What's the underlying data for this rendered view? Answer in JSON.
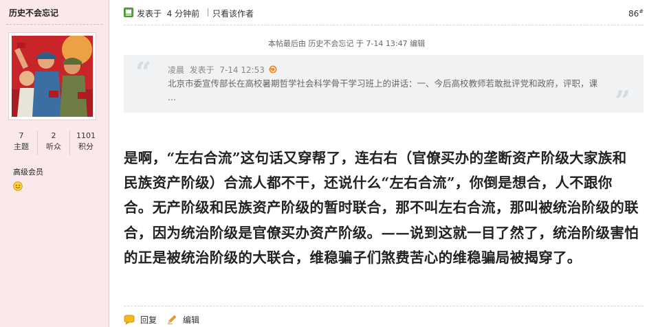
{
  "user": {
    "name": "历史不会忘记",
    "stats": [
      {
        "value": "7",
        "label": "主题"
      },
      {
        "value": "2",
        "label": "听众"
      },
      {
        "value": "1101",
        "label": "积分"
      }
    ],
    "group": "高级会员",
    "avatar_icon": "propaganda-poster-avatar",
    "status_icon": "smiley-icon"
  },
  "post": {
    "posted_label": "发表于",
    "posted_time": "4 分钟前",
    "only_author": "只看该作者",
    "floor_number": "86",
    "floor_mark": "#",
    "edit_note": "本帖最后由 历史不会忘记 于 7-14 13:47 编辑",
    "quote": {
      "author": "凌晨",
      "posted_label": "发表于",
      "posted_time": "7-14 12:53",
      "text": "北京市委宣传部长在高校暑期哲学社会科学骨干学习班上的讲话：一、今后高校教师若敢批评党和政府，评职，课 ..."
    },
    "body": "是啊，“左右合流”这句话又穿帮了，连右右（官僚买办的垄断资产阶级大家族和民族资产阶级）合流人都不干，还说什么“左右合流”，你倒是想合，人不跟你合。无产阶级和民族资产阶级的暂时联合，那不叫左右合流，那叫被统治阶级的联合，因为统治阶级是官僚买办资产阶级。——说到这就一目了然了，统治阶级害怕的正是被统治阶级的大联合，维稳骗子们煞费苦心的维稳骗局被揭穿了。",
    "actions": {
      "reply_label": "回复",
      "edit_label": "编辑"
    }
  },
  "colors": {
    "sidebar_bg": "#fbe8ea",
    "quote_bg": "#f1f2f4",
    "accent_green": "#5aa640",
    "jump_orange": "#f08a24"
  }
}
